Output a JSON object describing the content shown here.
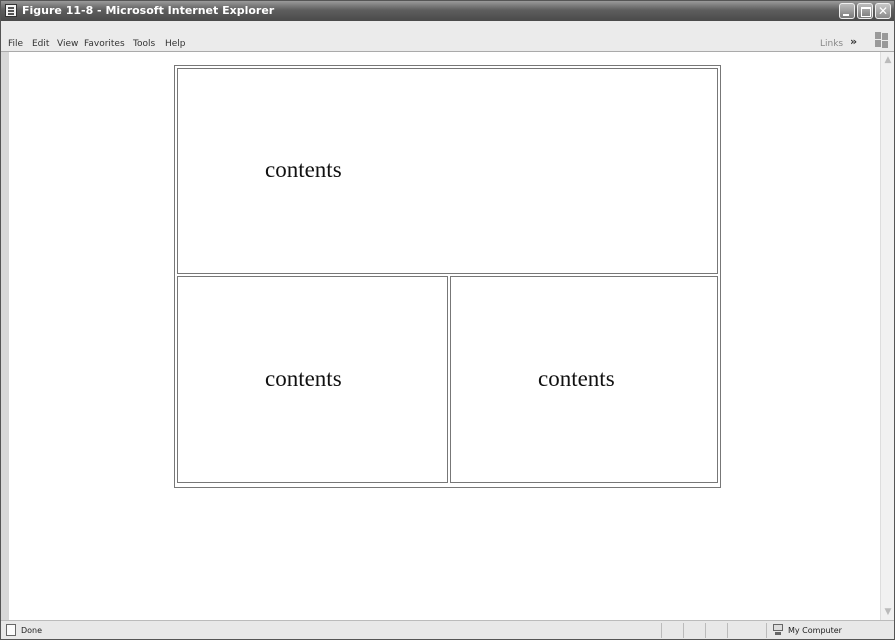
{
  "window": {
    "title": "Figure 11-8 - Microsoft Internet Explorer"
  },
  "menubar": {
    "items": [
      "File",
      "Edit",
      "View",
      "Favorites",
      "Tools",
      "Help"
    ],
    "links_label": "Links",
    "chevron": "»"
  },
  "frames": {
    "top": "contents",
    "bottom_left": "contents",
    "bottom_right": "contents"
  },
  "statusbar": {
    "status_text": "Done",
    "zone_text": "My Computer"
  }
}
